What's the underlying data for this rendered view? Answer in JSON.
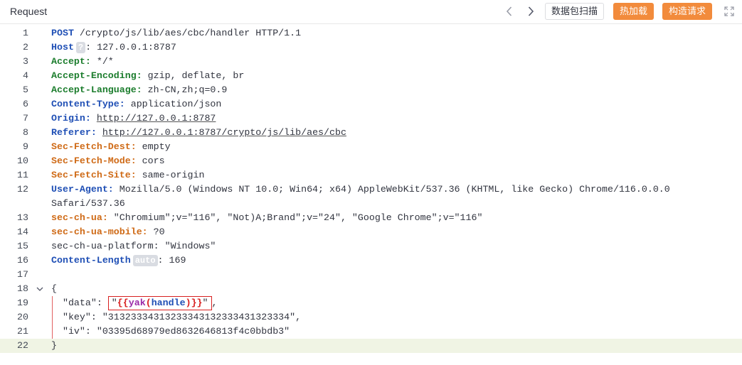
{
  "header": {
    "title": "Request",
    "prev_icon": "chevron-left-icon",
    "next_icon": "chevron-right-icon",
    "scan_label": "数据包扫描",
    "hotload_label": "热加载",
    "build_label": "构造请求",
    "expand_icon": "expand-icon"
  },
  "colors": {
    "orange": "#f28b3c",
    "header_blue": "#1f4fb5",
    "header_green": "#1c7d2d",
    "header_orange": "#cf6a16",
    "fuzz_red": "#d82020",
    "active_line": "#f0f4e4"
  },
  "request": {
    "l1": {
      "num": "1",
      "method": "POST",
      "path": " /crypto/js/lib/aes/cbc/handler HTTP/1.1"
    },
    "l2": {
      "num": "2",
      "name": "Host",
      "badge": "?",
      "value": ": 127.0.0.1:8787"
    },
    "l3": {
      "num": "3",
      "name": "Accept:",
      "value": " */*"
    },
    "l4": {
      "num": "4",
      "name": "Accept-Encoding:",
      "value": " gzip, deflate, br"
    },
    "l5": {
      "num": "5",
      "name": "Accept-Language:",
      "value": " zh-CN,zh;q=0.9"
    },
    "l6": {
      "num": "6",
      "name": "Content-Type:",
      "value": " application/json"
    },
    "l7": {
      "num": "7",
      "name": "Origin:",
      "value": "http://127.0.0.1:8787"
    },
    "l8": {
      "num": "8",
      "name": "Referer:",
      "value": "http://127.0.0.1:8787/crypto/js/lib/aes/cbc"
    },
    "l9": {
      "num": "9",
      "name": "Sec-Fetch-Dest:",
      "value": " empty"
    },
    "l10": {
      "num": "10",
      "name": "Sec-Fetch-Mode:",
      "value": " cors"
    },
    "l11": {
      "num": "11",
      "name": "Sec-Fetch-Site:",
      "value": " same-origin"
    },
    "l12": {
      "num": "12",
      "name": "User-Agent:",
      "value": " Mozilla/5.0 (Windows NT 10.0; Win64; x64) AppleWebKit/537.36 (KHTML, like Gecko) Chrome/116.0.0.0",
      "cont": "Safari/537.36"
    },
    "l13": {
      "num": "13",
      "name": "sec-ch-ua:",
      "value": " \"Chromium\";v=\"116\", \"Not)A;Brand\";v=\"24\", \"Google Chrome\";v=\"116\""
    },
    "l14": {
      "num": "14",
      "name": "sec-ch-ua-mobile:",
      "value": " ?0"
    },
    "l15": {
      "num": "15",
      "text": "sec-ch-ua-platform: \"Windows\""
    },
    "l16": {
      "num": "16",
      "name": "Content-Length",
      "badge": "auto",
      "value": ": 169"
    },
    "l17": {
      "num": "17"
    },
    "l18": {
      "num": "18",
      "text": "{"
    },
    "l19": {
      "num": "19",
      "key": "  \"data\": ",
      "q_open": "\"",
      "tag_open": "{{",
      "fn": "yak",
      "paren_open": "(",
      "arg": "handle",
      "paren_close": ")",
      "tag_close": "}}",
      "q_close": "\"",
      "tail": ","
    },
    "l20": {
      "num": "20",
      "text": "  \"key\": \"31323334313233343132333431323334\","
    },
    "l21": {
      "num": "21",
      "text": "  \"iv\": \"03395d68979ed8632646813f4c0bbdb3\""
    },
    "l22": {
      "num": "22",
      "text": "}"
    }
  }
}
